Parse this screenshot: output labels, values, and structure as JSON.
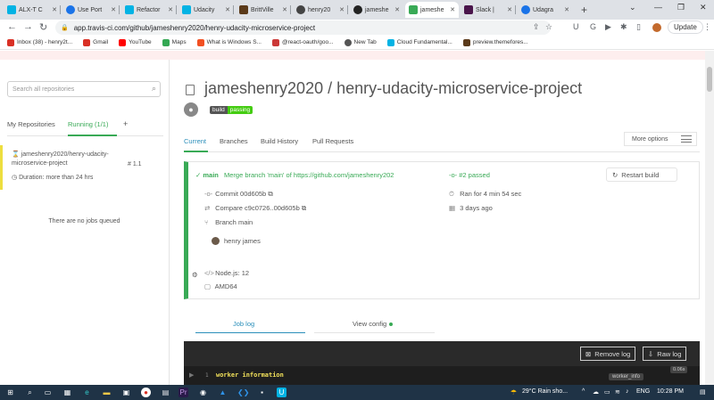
{
  "browser": {
    "tabs": [
      {
        "label": "ALX-T C",
        "color": "#02b3e4"
      },
      {
        "label": "Use Port",
        "color": "#1a73e8"
      },
      {
        "label": "Refactor",
        "color": "#02b3e4"
      },
      {
        "label": "Udacity",
        "color": "#02b3e4"
      },
      {
        "label": "BrittVille",
        "color": "#5b3a1a"
      },
      {
        "label": "henry20",
        "color": "#444"
      },
      {
        "label": "jameshe",
        "color": "#222"
      },
      {
        "label": "jameshe",
        "color": "#39aa56"
      },
      {
        "label": "Slack |",
        "color": "#4a154b"
      },
      {
        "label": "Udagra",
        "color": "#1a73e8"
      }
    ],
    "url": "app.travis-ci.com/github/jameshenry2020/henry-udacity-microservice-project",
    "update_label": "Update",
    "bookmarks": [
      {
        "label": "Inbox (38) - henry2t...",
        "color": "#d93025"
      },
      {
        "label": "Gmail",
        "color": "#d93025"
      },
      {
        "label": "YouTube",
        "color": "#ff0000"
      },
      {
        "label": "Maps",
        "color": "#34a853"
      },
      {
        "label": "What is Windows S...",
        "color": "#f25022"
      },
      {
        "label": "@react-oauth/goo...",
        "color": "#cb3837"
      },
      {
        "label": "New Tab",
        "color": "#555"
      },
      {
        "label": "Cloud Fundamental...",
        "color": "#02b3e4"
      },
      {
        "label": "preview.themefores...",
        "color": "#5b3a1a"
      }
    ]
  },
  "sidebar": {
    "search_placeholder": "Search all repositories",
    "tab_my": "My Repositories",
    "tab_running": "Running (1/1)",
    "plus": "+",
    "job": {
      "name": "jameshenry2020/henry-udacity-microservice-project",
      "number": "1.1",
      "duration": "Duration: more than 24 hrs"
    },
    "no_jobs": "There are no jobs queued"
  },
  "repo": {
    "title": "jameshenry2020 / henry-udacity-microservice-project",
    "badge_left": "build",
    "badge_right": "passing",
    "tabs": [
      "Current",
      "Branches",
      "Build History",
      "Pull Requests"
    ],
    "more_options": "More options"
  },
  "build": {
    "branch": "main",
    "message": "Merge branch 'main' of https://github.com/jameshenry202",
    "number": "#2 passed",
    "commit_label": "Commit",
    "commit_hash": "00d605b",
    "compare_label": "Compare",
    "compare_range": "c9c0726..00d605b",
    "branch_label": "Branch",
    "branch_name": "main",
    "author": "henry james",
    "ran_for": "Ran for 4 min 54 sec",
    "when": "3 days ago",
    "restart": "Restart build",
    "language": "Node.js: 12",
    "arch": "AMD64"
  },
  "log": {
    "tab_job": "Job log",
    "tab_config": "View config",
    "remove": "Remove log",
    "raw": "Raw log",
    "line_number": "1",
    "line_text": "worker information",
    "tag": "worker_info",
    "time": "0.06s"
  },
  "taskbar": {
    "weather": "29°C  Rain sho...",
    "lang": "ENG",
    "time": "10:28 PM"
  },
  "colors": {
    "passing": "#39aa56",
    "running": "#edde3f",
    "link": "#2b8fba"
  }
}
